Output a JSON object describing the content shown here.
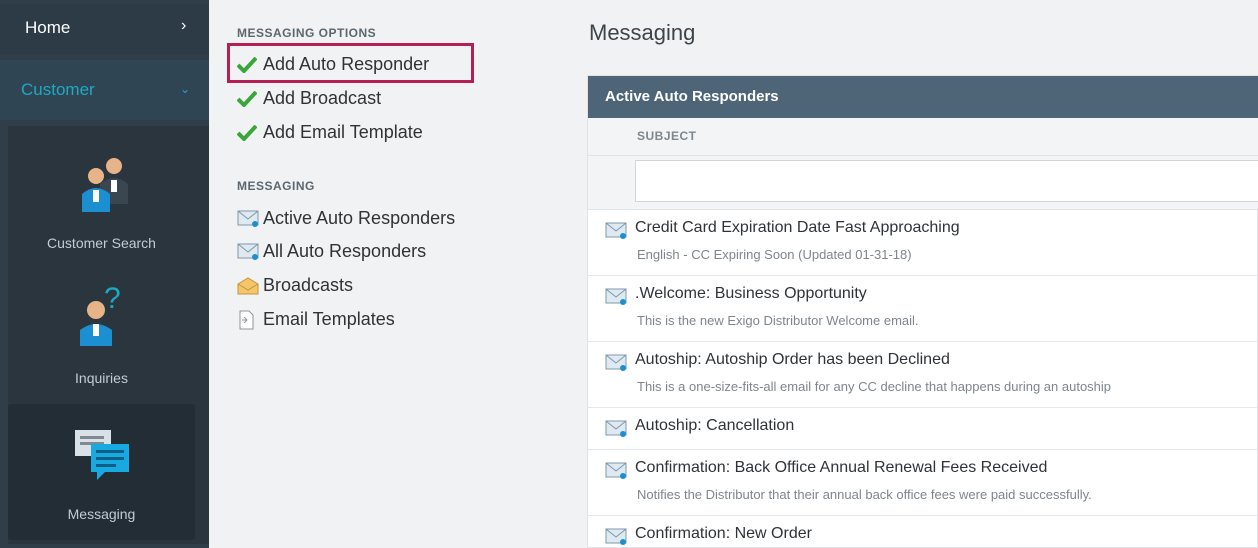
{
  "nav": {
    "home_label": "Home",
    "home_chevron": "›",
    "customer_label": "Customer",
    "customer_chevron": "⌄",
    "tiles": [
      {
        "label": "Customer Search",
        "icon": "customer-search-icon"
      },
      {
        "label": "Inquiries",
        "icon": "inquiries-icon"
      },
      {
        "label": "Messaging",
        "icon": "messaging-icon"
      }
    ]
  },
  "messaging_options": {
    "title": "MESSAGING OPTIONS",
    "items": [
      {
        "label": "Add Auto Responder",
        "icon": "checkmark-icon"
      },
      {
        "label": "Add Broadcast",
        "icon": "checkmark-icon"
      },
      {
        "label": "Add Email Template",
        "icon": "checkmark-icon"
      }
    ]
  },
  "messaging": {
    "title": "MESSAGING",
    "items": [
      {
        "label": "Active Auto Responders",
        "icon": "envelope-icon"
      },
      {
        "label": "All Auto Responders",
        "icon": "envelope-icon"
      },
      {
        "label": "Broadcasts",
        "icon": "open-envelope-icon"
      },
      {
        "label": "Email Templates",
        "icon": "document-icon"
      }
    ]
  },
  "main": {
    "title": "Messaging",
    "panel_title": "Active Auto Responders",
    "column_subject": "SUBJECT",
    "filter_value": "",
    "rows": [
      {
        "subject": "Credit Card Expiration Date Fast Approaching",
        "description": "English - CC Expiring Soon (Updated 01-31-18)"
      },
      {
        "subject": ".Welcome: Business Opportunity",
        "description": "This is the new Exigo Distributor Welcome email."
      },
      {
        "subject": "Autoship: Autoship Order has been Declined",
        "description": "This is a one-size-fits-all email for any CC decline that happens during an autoship"
      },
      {
        "subject": "Autoship: Cancellation",
        "description": ""
      },
      {
        "subject": "Confirmation: Back Office Annual Renewal Fees Received",
        "description": "Notifies the Distributor that their annual back office fees were paid successfully."
      },
      {
        "subject": "Confirmation: New Order",
        "description": ""
      }
    ]
  },
  "colors": {
    "nav_bg": "#2f3e49",
    "accent": "#1ea8c2",
    "check_green": "#3aa63a",
    "highlight_border": "#b51f55",
    "panel_header": "#4d6577"
  }
}
